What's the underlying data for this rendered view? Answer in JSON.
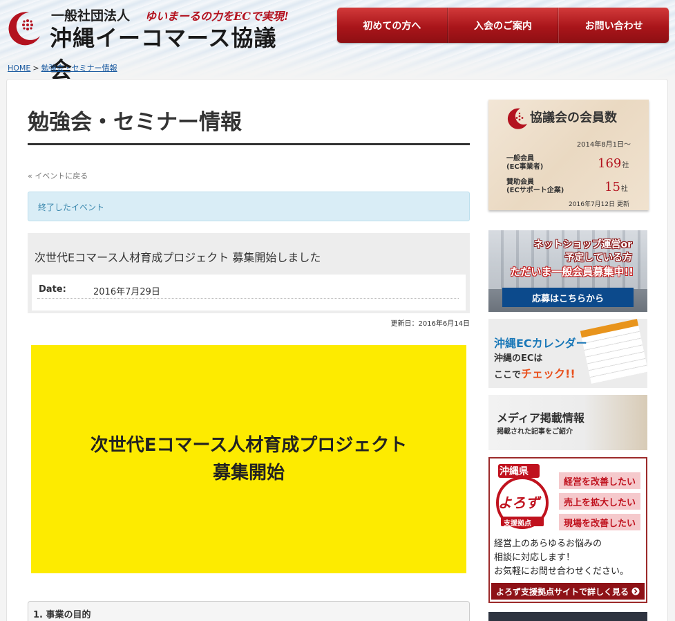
{
  "header": {
    "org_type": "一般社団法人",
    "tagline": "ゆいまーるの力をECで実現!",
    "org_name": "沖縄イーコマース協議会"
  },
  "nav": [
    "初めての方へ",
    "入会のご案内",
    "お問い合わせ"
  ],
  "breadcrumb": {
    "home": "HOME",
    "sep": ">",
    "current": "勉強会・セミナー情報"
  },
  "main": {
    "page_title": "勉強会・セミナー情報",
    "back_link": "« イベントに戻る",
    "notice": "終了したイベント",
    "event_title": "次世代Eコマース人材育成プロジェクト 募集開始しました",
    "date_label": "Date:",
    "date_value": "2016年7月29日",
    "updated": "更新日：2016年6月14日",
    "banner_line1": "次世代Eコマース人材育成プロジェクト",
    "banner_line2": "募集開始",
    "section_head": "1. 事業の目的"
  },
  "sidebar": {
    "members": {
      "title": "協議会の会員数",
      "date": "2014年8月1日～",
      "general_label_1": "一般会員",
      "general_label_2": "(EC事業者)",
      "general_count": "169",
      "support_label_1": "賛助会員",
      "support_label_2": "(ECサポート企業)",
      "support_count": "15",
      "unit": "社",
      "updated": "2016年7月12日 更新"
    },
    "join_ad": {
      "line1": "ネットショップ運営or",
      "line2": "予定している方",
      "line3": "ただいま一般会員募集中!!",
      "button": "応募はこちらから"
    },
    "calendar_ad": {
      "line1": "沖縄ECカレンダー",
      "line2": "沖縄のECは",
      "line3_a": "ここで",
      "line3_b": "チェック!!"
    },
    "media_ad": {
      "line1": "メディア掲載情報",
      "line2": "掲載された記事をご紹介"
    },
    "yorozu_ad": {
      "badge_top": "沖縄県",
      "badge_main": "よろず",
      "badge_sub": "支援拠点",
      "pills": [
        "経営を改善したい",
        "売上を拡大したい",
        "現場を改善したい"
      ],
      "body": [
        "経営上のあらゆるお悩みの",
        "相談に対応します！",
        "お気軽にお問せ合わせください。"
      ],
      "cta": "よろず支援拠点サイトで詳しく見る"
    }
  },
  "colors": {
    "brand_red": "#b3121f",
    "notice_bg": "#d9edf6",
    "banner_yellow": "#fdeb00",
    "link_blue": "#1a5aa0"
  }
}
